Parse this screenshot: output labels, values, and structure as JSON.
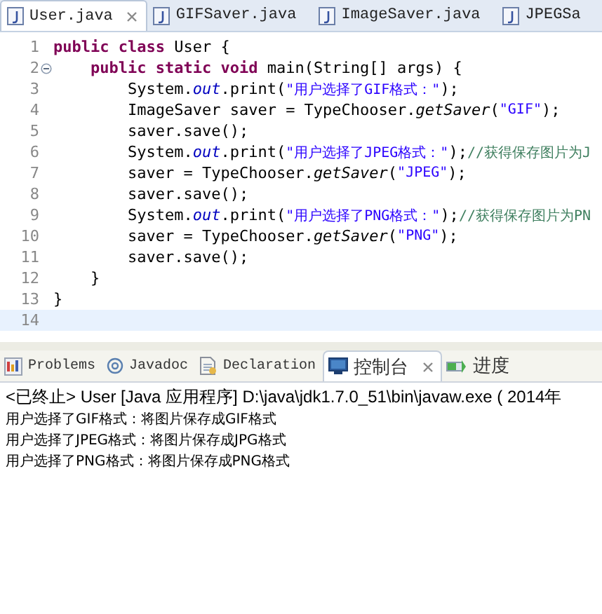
{
  "editor_tabs": [
    {
      "label": "User.java",
      "selected": true,
      "closable": true
    },
    {
      "label": "GIFSaver.java",
      "selected": false,
      "closable": false
    },
    {
      "label": "ImageSaver.java",
      "selected": false,
      "closable": false
    },
    {
      "label": "JPEGSa",
      "selected": false,
      "closable": false
    }
  ],
  "code_lines": [
    {
      "number": "1",
      "fold_marker": false,
      "current": false,
      "tokens": [
        {
          "kind": "keyword",
          "text": "public class"
        },
        {
          "kind": "plain",
          "text": " User {"
        }
      ]
    },
    {
      "number": "2",
      "fold_marker": true,
      "current": false,
      "tokens": [
        {
          "kind": "keyword",
          "text": "    public static void"
        },
        {
          "kind": "plain",
          "text": " main(String[] args) {"
        }
      ]
    },
    {
      "number": "3",
      "fold_marker": false,
      "current": false,
      "tokens": [
        {
          "kind": "plain",
          "text": "        System."
        },
        {
          "kind": "field",
          "text": "out"
        },
        {
          "kind": "plain",
          "text": ".print("
        },
        {
          "kind": "string",
          "text": "\"用户选择了GIF格式：\""
        },
        {
          "kind": "plain",
          "text": ");"
        }
      ]
    },
    {
      "number": "4",
      "fold_marker": false,
      "current": false,
      "tokens": [
        {
          "kind": "plain",
          "text": "        ImageSaver saver = TypeChooser."
        },
        {
          "kind": "method",
          "text": "getSaver"
        },
        {
          "kind": "plain",
          "text": "("
        },
        {
          "kind": "string",
          "text": "\"GIF\""
        },
        {
          "kind": "plain",
          "text": ");"
        }
      ]
    },
    {
      "number": "5",
      "fold_marker": false,
      "current": false,
      "tokens": [
        {
          "kind": "plain",
          "text": "        saver.save();"
        }
      ]
    },
    {
      "number": "6",
      "fold_marker": false,
      "current": false,
      "tokens": [
        {
          "kind": "plain",
          "text": "        System."
        },
        {
          "kind": "field",
          "text": "out"
        },
        {
          "kind": "plain",
          "text": ".print("
        },
        {
          "kind": "string",
          "text": "\"用户选择了JPEG格式：\""
        },
        {
          "kind": "plain",
          "text": ");"
        },
        {
          "kind": "comment",
          "text": "//获得保存图片为J"
        }
      ]
    },
    {
      "number": "7",
      "fold_marker": false,
      "current": false,
      "tokens": [
        {
          "kind": "plain",
          "text": "        saver = TypeChooser."
        },
        {
          "kind": "method",
          "text": "getSaver"
        },
        {
          "kind": "plain",
          "text": "("
        },
        {
          "kind": "string",
          "text": "\"JPEG\""
        },
        {
          "kind": "plain",
          "text": ");"
        }
      ]
    },
    {
      "number": "8",
      "fold_marker": false,
      "current": false,
      "tokens": [
        {
          "kind": "plain",
          "text": "        saver.save();"
        }
      ]
    },
    {
      "number": "9",
      "fold_marker": false,
      "current": false,
      "tokens": [
        {
          "kind": "plain",
          "text": "        System."
        },
        {
          "kind": "field",
          "text": "out"
        },
        {
          "kind": "plain",
          "text": ".print("
        },
        {
          "kind": "string",
          "text": "\"用户选择了PNG格式：\""
        },
        {
          "kind": "plain",
          "text": ");"
        },
        {
          "kind": "comment",
          "text": "//获得保存图片为PN"
        }
      ]
    },
    {
      "number": "10",
      "fold_marker": false,
      "current": false,
      "tokens": [
        {
          "kind": "plain",
          "text": "        saver = TypeChooser."
        },
        {
          "kind": "method",
          "text": "getSaver"
        },
        {
          "kind": "plain",
          "text": "("
        },
        {
          "kind": "string",
          "text": "\"PNG\""
        },
        {
          "kind": "plain",
          "text": ");"
        }
      ]
    },
    {
      "number": "11",
      "fold_marker": false,
      "current": false,
      "tokens": [
        {
          "kind": "plain",
          "text": "        saver.save();"
        }
      ]
    },
    {
      "number": "12",
      "fold_marker": false,
      "current": false,
      "tokens": [
        {
          "kind": "plain",
          "text": "    }"
        }
      ]
    },
    {
      "number": "13",
      "fold_marker": false,
      "current": false,
      "tokens": [
        {
          "kind": "plain",
          "text": "}"
        }
      ]
    },
    {
      "number": "14",
      "fold_marker": false,
      "current": true
    }
  ],
  "console_tabs": [
    {
      "label": "Problems",
      "kind": "problems",
      "selected": false,
      "closable": false
    },
    {
      "label": "Javadoc",
      "kind": "javadoc",
      "selected": false,
      "closable": false
    },
    {
      "label": "Declaration",
      "kind": "declaration",
      "selected": false,
      "closable": false
    },
    {
      "label": "控制台",
      "kind": "console",
      "selected": true,
      "closable": true
    },
    {
      "label": "进度",
      "kind": "progress",
      "selected": false,
      "closable": false
    }
  ],
  "console": {
    "header": "<已终止> User [Java 应用程序] D:\\java\\jdk1.7.0_51\\bin\\javaw.exe ( 2014年",
    "output": [
      "用户选择了GIF格式：将图片保存成GIF格式",
      "用户选择了JPEG格式：将图片保存成JPG格式",
      "用户选择了PNG格式：将图片保存成PNG格式"
    ]
  }
}
